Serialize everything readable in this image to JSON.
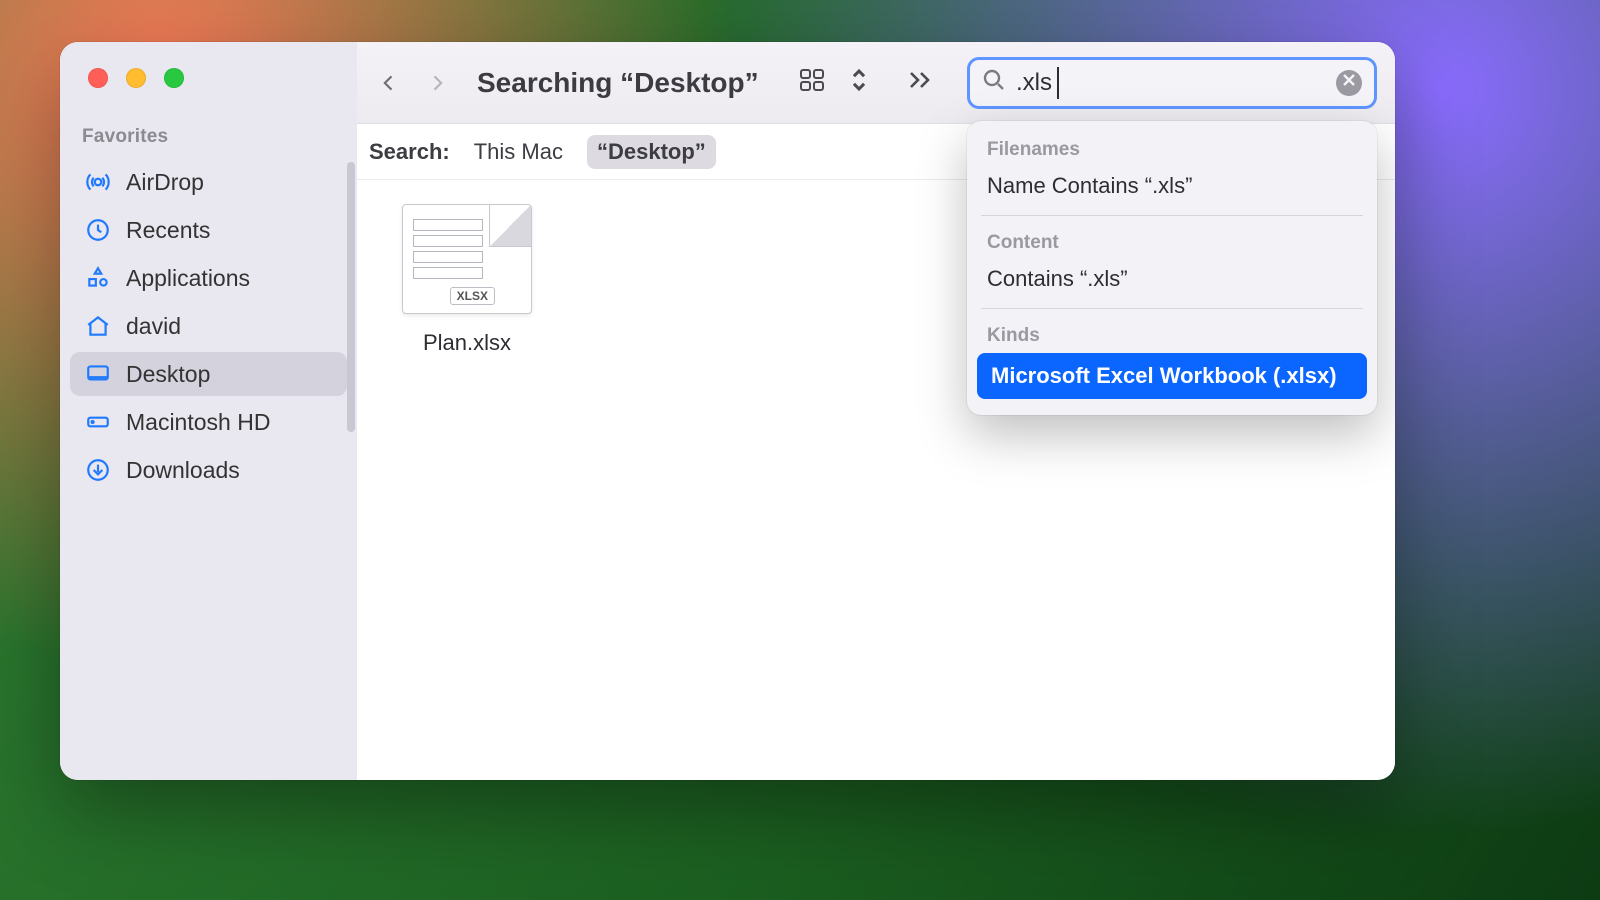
{
  "window": {
    "title": "Searching “Desktop”"
  },
  "traffic_lights": {
    "close": "#ff5f57",
    "minimize": "#febc2e",
    "zoom": "#28c840"
  },
  "sidebar": {
    "section_label": "Favorites",
    "items": [
      {
        "label": "AirDrop",
        "icon": "airdrop-icon",
        "active": false
      },
      {
        "label": "Recents",
        "icon": "clock-icon",
        "active": false
      },
      {
        "label": "Applications",
        "icon": "apps-icon",
        "active": false
      },
      {
        "label": "david",
        "icon": "home-icon",
        "active": false
      },
      {
        "label": "Desktop",
        "icon": "desktop-icon",
        "active": true
      },
      {
        "label": "Macintosh HD",
        "icon": "drive-icon",
        "active": false
      },
      {
        "label": "Downloads",
        "icon": "download-icon",
        "active": false
      }
    ]
  },
  "toolbar": {
    "back_enabled": true,
    "forward_enabled": false
  },
  "search": {
    "value": ".xls",
    "clear_visible": true
  },
  "scope": {
    "label": "Search:",
    "options": [
      {
        "label": "This Mac",
        "active": false
      },
      {
        "label": "“Desktop”",
        "active": true
      }
    ]
  },
  "results": [
    {
      "name": "Plan.xlsx",
      "badge": "XLSX"
    }
  ],
  "suggestions": {
    "sections": [
      {
        "label": "Filenames",
        "items": [
          {
            "text": "Name Contains “.xls”",
            "selected": false
          }
        ]
      },
      {
        "label": "Content",
        "items": [
          {
            "text": "Contains “.xls”",
            "selected": false
          }
        ]
      },
      {
        "label": "Kinds",
        "items": [
          {
            "text": "Microsoft Excel Workbook (.xlsx)",
            "selected": true
          }
        ]
      }
    ]
  }
}
